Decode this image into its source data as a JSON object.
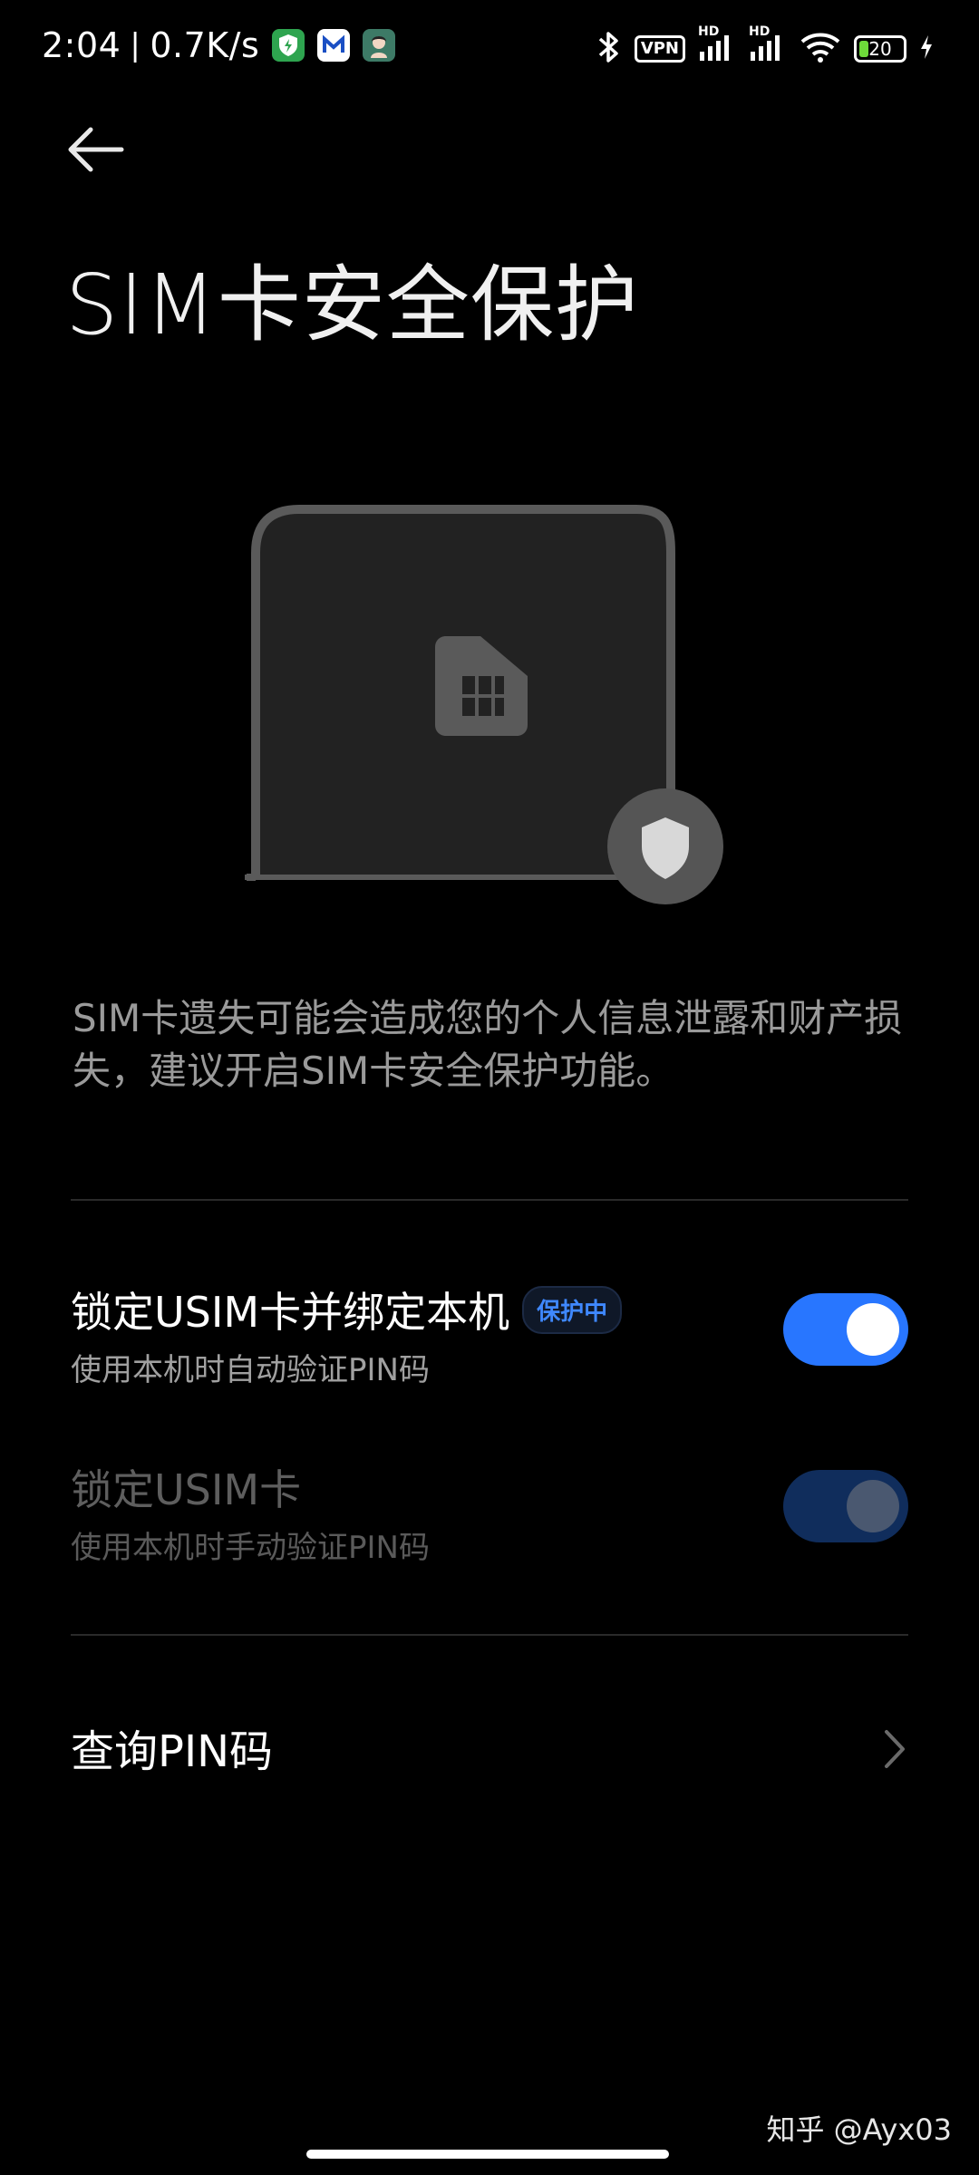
{
  "status_bar": {
    "time": "2:04",
    "speed": "0.7K/s",
    "vpn_label": "VPN",
    "hd1": "HD",
    "hd2": "HD",
    "battery": "20",
    "icons": [
      "shield-app-icon",
      "mail-app-icon",
      "avatar-app-icon",
      "bluetooth-icon",
      "vpn-icon",
      "signal-icon",
      "signal-icon",
      "wifi-icon",
      "battery-icon",
      "charging-icon"
    ]
  },
  "header": {
    "title": "SIM卡安全保护"
  },
  "description": "SIM卡遗失可能会造成您的个人信息泄露和财产损失，建议开启SIM卡安全保护功能。",
  "settings": [
    {
      "title": "锁定USIM卡并绑定本机",
      "badge": "保护中",
      "subtitle": "使用本机时自动验证PIN码",
      "enabled": true,
      "disabled": false
    },
    {
      "title": "锁定USIM卡",
      "subtitle": "使用本机时手动验证PIN码",
      "enabled": true,
      "disabled": true
    }
  ],
  "pin_query": {
    "label": "查询PIN码"
  },
  "watermark": "知乎 @Ayx03",
  "colors": {
    "accent": "#2876ff",
    "background": "#000000"
  }
}
